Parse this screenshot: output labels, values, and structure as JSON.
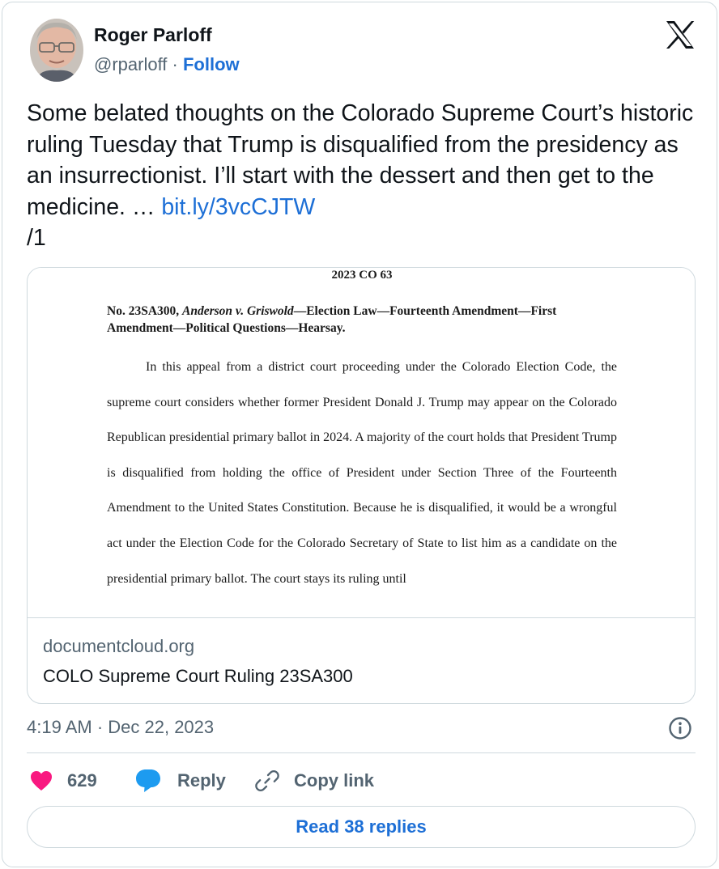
{
  "author": {
    "name": "Roger Parloff",
    "handle": "@rparloff",
    "separator": "·",
    "follow_label": "Follow"
  },
  "tweet": {
    "text": "Some belated thoughts on the Colorado Supreme Court’s historic ruling Tuesday that Trump is disqualified from the presidency as an insurrectionist. I’ll start with the dessert and then get to the medicine. … ",
    "link_text": "bit.ly/3vcCJTW",
    "thread_marker": "/1"
  },
  "link_card": {
    "doc_citation": "2023 CO 63",
    "doc_heading_prefix": "No. 23SA300, ",
    "doc_heading_case": "Anderson v. Griswold",
    "doc_heading_rest": "—Election Law—Fourteenth Amendment—First Amendment—Political Questions—Hearsay.",
    "doc_body": "In this appeal from a district court proceeding under the Colorado Election Code, the supreme court considers whether former President Donald J. Trump may appear on the Colorado Republican presidential primary ballot in 2024.  A majority of the court holds that President Trump is disqualified from holding the office of President under Section Three of the Fourteenth Amendment to the United States Constitution.  Because he is disqualified, it would be a wrongful act under the Election Code for the Colorado Secretary of State to list him as a candidate on the presidential primary ballot.  The court stays its ruling until",
    "domain": "documentcloud.org",
    "title": "COLO Supreme Court Ruling 23SA300"
  },
  "meta": {
    "timestamp": "4:19 AM · Dec 22, 2023",
    "info_icon": "info-icon"
  },
  "actions": {
    "like_count": "629",
    "reply_label": "Reply",
    "copy_label": "Copy link",
    "read_replies_label": "Read 38 replies"
  },
  "colors": {
    "accent": "#1d6fd6",
    "like": "#f91880",
    "reply": "#1d9bf0",
    "muted": "#536471",
    "border": "#cfd9de"
  },
  "icons": [
    "x-logo-icon",
    "heart-icon",
    "reply-bubble-icon",
    "link-icon",
    "info-icon"
  ]
}
